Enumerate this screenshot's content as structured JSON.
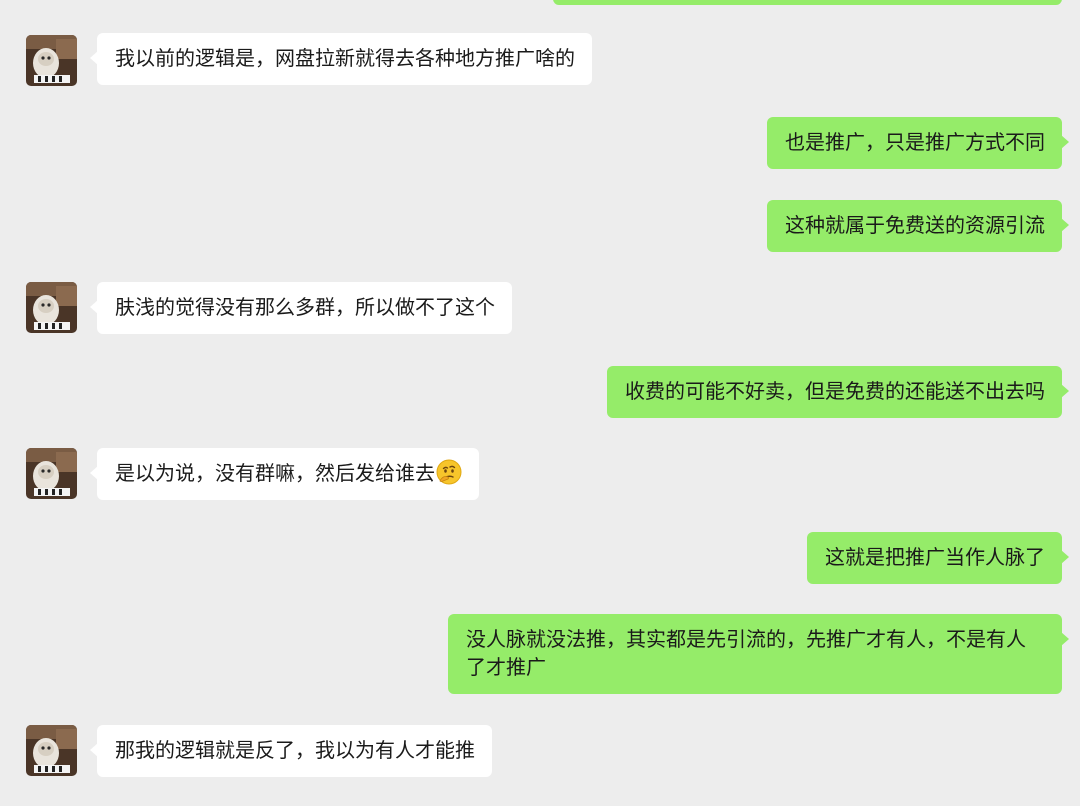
{
  "colors": {
    "background": "#ededed",
    "incoming_bubble": "#ffffff",
    "outgoing_bubble": "#95ec69",
    "text": "#1a1a1a"
  },
  "messages": [
    {
      "side": "left",
      "icon": "user-avatar",
      "text": "我以前的逻辑是，网盘拉新就得去各种地方推广啥的"
    },
    {
      "side": "right",
      "text": "也是推广，只是推广方式不同"
    },
    {
      "side": "right",
      "text": "这种就属于免费送的资源引流"
    },
    {
      "side": "left",
      "icon": "user-avatar",
      "text": "肤浅的觉得没有那么多群，所以做不了这个"
    },
    {
      "side": "right",
      "text": "收费的可能不好卖，但是免费的还能送不出去吗"
    },
    {
      "side": "left",
      "icon": "user-avatar",
      "text": "是以为说，没有群嘛，然后发给谁去",
      "emoji": "thinking-face-emoji"
    },
    {
      "side": "right",
      "text": "这就是把推广当作人脉了"
    },
    {
      "side": "right",
      "text": "没人脉就没法推，其实都是先引流的，先推广才有人，不是有人了才推广"
    },
    {
      "side": "left",
      "icon": "user-avatar",
      "text": "那我的逻辑就是反了，我以为有人才能推"
    }
  ]
}
